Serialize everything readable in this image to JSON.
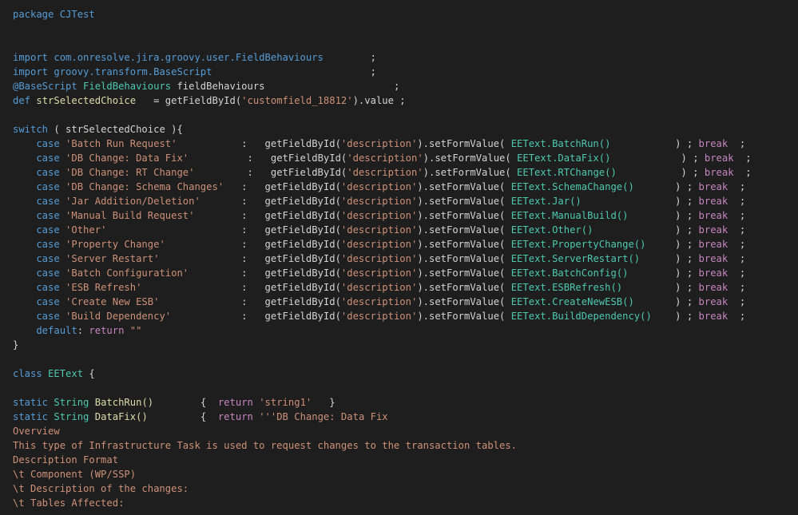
{
  "editor": {
    "theme": {
      "background": "#1e1e1e",
      "default": "#d4d4d4",
      "keyword": "#569cd6",
      "control": "#c586c0",
      "string": "#ce9178",
      "function": "#dcdcaa",
      "class": "#4ec9b0",
      "variable": "#9cdcfe"
    },
    "lines": [
      {
        "row": 0,
        "tokens": [
          {
            "t": "package",
            "c": "kw"
          },
          {
            "t": " CJTest",
            "c": "kw"
          }
        ]
      },
      {
        "row": 3,
        "tokens": [
          {
            "t": "import",
            "c": "kw"
          },
          {
            "t": " com.onresolve.jira.groovy.user.FieldBehaviours",
            "c": "kw"
          },
          {
            "t": "        ;",
            "c": "plain"
          }
        ]
      },
      {
        "row": 4,
        "tokens": [
          {
            "t": "import",
            "c": "kw"
          },
          {
            "t": " groovy.transform.BaseScript",
            "c": "kw"
          },
          {
            "t": "                           ;",
            "c": "plain"
          }
        ]
      },
      {
        "row": 5,
        "tokens": [
          {
            "t": "@BaseScript",
            "c": "kw"
          },
          {
            "t": " FieldBehaviours",
            "c": "cls"
          },
          {
            "t": " fieldBehaviours",
            "c": "plain"
          },
          {
            "t": "                      ;",
            "c": "plain"
          }
        ]
      },
      {
        "row": 6,
        "tokens": [
          {
            "t": "def",
            "c": "kw"
          },
          {
            "t": " strSelectedChoice",
            "c": "fn"
          },
          {
            "t": "   = getFieldById(",
            "c": "plain"
          },
          {
            "t": "'customfield_18812'",
            "c": "str"
          },
          {
            "t": ").value ;",
            "c": "plain"
          }
        ]
      },
      {
        "row": 8,
        "tokens": [
          {
            "t": "switch",
            "c": "kw"
          },
          {
            "t": " ( strSelectedChoice ){",
            "c": "plain"
          }
        ]
      },
      {
        "row": 9,
        "tokens": [
          {
            "t": "    case",
            "c": "kw"
          },
          {
            "t": " 'Batch Run Request'",
            "c": "str"
          },
          {
            "t": "           :   getFieldById(",
            "c": "plain"
          },
          {
            "t": "'description'",
            "c": "str"
          },
          {
            "t": ").setFormValue( ",
            "c": "plain"
          },
          {
            "t": "EEText",
            "c": "cls"
          },
          {
            "t": ".BatchRun()",
            "c": "cls"
          },
          {
            "t": "           ) ; ",
            "c": "plain"
          },
          {
            "t": "break",
            "c": "ctl"
          },
          {
            "t": "  ;",
            "c": "plain"
          }
        ]
      },
      {
        "row": 10,
        "tokens": [
          {
            "t": "    case",
            "c": "kw"
          },
          {
            "t": " 'DB Change: Data Fix'",
            "c": "str"
          },
          {
            "t": "          :   getFieldById(",
            "c": "plain"
          },
          {
            "t": "'description'",
            "c": "str"
          },
          {
            "t": ").setFormValue( ",
            "c": "plain"
          },
          {
            "t": "EEText",
            "c": "cls"
          },
          {
            "t": ".DataFix()",
            "c": "cls"
          },
          {
            "t": "            ) ; ",
            "c": "plain"
          },
          {
            "t": "break",
            "c": "ctl"
          },
          {
            "t": "  ;",
            "c": "plain"
          }
        ]
      },
      {
        "row": 11,
        "tokens": [
          {
            "t": "    case",
            "c": "kw"
          },
          {
            "t": " 'DB Change: RT Change'",
            "c": "str"
          },
          {
            "t": "         :   getFieldById(",
            "c": "plain"
          },
          {
            "t": "'description'",
            "c": "str"
          },
          {
            "t": ").setFormValue( ",
            "c": "plain"
          },
          {
            "t": "EEText",
            "c": "cls"
          },
          {
            "t": ".RTChange()",
            "c": "cls"
          },
          {
            "t": "           ) ; ",
            "c": "plain"
          },
          {
            "t": "break",
            "c": "ctl"
          },
          {
            "t": "  ;",
            "c": "plain"
          }
        ]
      },
      {
        "row": 12,
        "tokens": [
          {
            "t": "    case",
            "c": "kw"
          },
          {
            "t": " 'DB Change: Schema Changes'",
            "c": "str"
          },
          {
            "t": "   :   getFieldById(",
            "c": "plain"
          },
          {
            "t": "'description'",
            "c": "str"
          },
          {
            "t": ").setFormValue( ",
            "c": "plain"
          },
          {
            "t": "EEText",
            "c": "cls"
          },
          {
            "t": ".SchemaChange()",
            "c": "cls"
          },
          {
            "t": "       ) ; ",
            "c": "plain"
          },
          {
            "t": "break",
            "c": "ctl"
          },
          {
            "t": "  ;",
            "c": "plain"
          }
        ]
      },
      {
        "row": 13,
        "tokens": [
          {
            "t": "    case",
            "c": "kw"
          },
          {
            "t": " 'Jar Addition/Deletion'",
            "c": "str"
          },
          {
            "t": "       :   getFieldById(",
            "c": "plain"
          },
          {
            "t": "'description'",
            "c": "str"
          },
          {
            "t": ").setFormValue( ",
            "c": "plain"
          },
          {
            "t": "EEText",
            "c": "cls"
          },
          {
            "t": ".Jar()",
            "c": "cls"
          },
          {
            "t": "                ) ; ",
            "c": "plain"
          },
          {
            "t": "break",
            "c": "ctl"
          },
          {
            "t": "  ;",
            "c": "plain"
          }
        ]
      },
      {
        "row": 14,
        "tokens": [
          {
            "t": "    case",
            "c": "kw"
          },
          {
            "t": " 'Manual Build Request'",
            "c": "str"
          },
          {
            "t": "        :   getFieldById(",
            "c": "plain"
          },
          {
            "t": "'description'",
            "c": "str"
          },
          {
            "t": ").setFormValue( ",
            "c": "plain"
          },
          {
            "t": "EEText",
            "c": "cls"
          },
          {
            "t": ".ManualBuild()",
            "c": "cls"
          },
          {
            "t": "        ) ; ",
            "c": "plain"
          },
          {
            "t": "break",
            "c": "ctl"
          },
          {
            "t": "  ;",
            "c": "plain"
          }
        ]
      },
      {
        "row": 15,
        "tokens": [
          {
            "t": "    case",
            "c": "kw"
          },
          {
            "t": " 'Other'",
            "c": "str"
          },
          {
            "t": "                       :   getFieldById(",
            "c": "plain"
          },
          {
            "t": "'description'",
            "c": "str"
          },
          {
            "t": ").setFormValue( ",
            "c": "plain"
          },
          {
            "t": "EEText",
            "c": "cls"
          },
          {
            "t": ".Other()",
            "c": "cls"
          },
          {
            "t": "              ) ; ",
            "c": "plain"
          },
          {
            "t": "break",
            "c": "ctl"
          },
          {
            "t": "  ;",
            "c": "plain"
          }
        ]
      },
      {
        "row": 16,
        "tokens": [
          {
            "t": "    case",
            "c": "kw"
          },
          {
            "t": " 'Property Change'",
            "c": "str"
          },
          {
            "t": "             :   getFieldById(",
            "c": "plain"
          },
          {
            "t": "'description'",
            "c": "str"
          },
          {
            "t": ").setFormValue( ",
            "c": "plain"
          },
          {
            "t": "EEText",
            "c": "cls"
          },
          {
            "t": ".PropertyChange()",
            "c": "cls"
          },
          {
            "t": "     ) ; ",
            "c": "plain"
          },
          {
            "t": "break",
            "c": "ctl"
          },
          {
            "t": "  ;",
            "c": "plain"
          }
        ]
      },
      {
        "row": 17,
        "tokens": [
          {
            "t": "    case",
            "c": "kw"
          },
          {
            "t": " 'Server Restart'",
            "c": "str"
          },
          {
            "t": "              :   getFieldById(",
            "c": "plain"
          },
          {
            "t": "'description'",
            "c": "str"
          },
          {
            "t": ").setFormValue( ",
            "c": "plain"
          },
          {
            "t": "EEText",
            "c": "cls"
          },
          {
            "t": ".ServerRestart()",
            "c": "cls"
          },
          {
            "t": "      ) ; ",
            "c": "plain"
          },
          {
            "t": "break",
            "c": "ctl"
          },
          {
            "t": "  ;",
            "c": "plain"
          }
        ]
      },
      {
        "row": 18,
        "tokens": [
          {
            "t": "    case",
            "c": "kw"
          },
          {
            "t": " 'Batch Configuration'",
            "c": "str"
          },
          {
            "t": "         :   getFieldById(",
            "c": "plain"
          },
          {
            "t": "'description'",
            "c": "str"
          },
          {
            "t": ").setFormValue( ",
            "c": "plain"
          },
          {
            "t": "EEText",
            "c": "cls"
          },
          {
            "t": ".BatchConfig()",
            "c": "cls"
          },
          {
            "t": "        ) ; ",
            "c": "plain"
          },
          {
            "t": "break",
            "c": "ctl"
          },
          {
            "t": "  ;",
            "c": "plain"
          }
        ]
      },
      {
        "row": 19,
        "tokens": [
          {
            "t": "    case",
            "c": "kw"
          },
          {
            "t": " 'ESB Refresh'",
            "c": "str"
          },
          {
            "t": "                 :   getFieldById(",
            "c": "plain"
          },
          {
            "t": "'description'",
            "c": "str"
          },
          {
            "t": ").setFormValue( ",
            "c": "plain"
          },
          {
            "t": "EEText",
            "c": "cls"
          },
          {
            "t": ".ESBRefresh()",
            "c": "cls"
          },
          {
            "t": "         ) ; ",
            "c": "plain"
          },
          {
            "t": "break",
            "c": "ctl"
          },
          {
            "t": "  ;",
            "c": "plain"
          }
        ]
      },
      {
        "row": 20,
        "tokens": [
          {
            "t": "    case",
            "c": "kw"
          },
          {
            "t": " 'Create New ESB'",
            "c": "str"
          },
          {
            "t": "              :   getFieldById(",
            "c": "plain"
          },
          {
            "t": "'description'",
            "c": "str"
          },
          {
            "t": ").setFormValue( ",
            "c": "plain"
          },
          {
            "t": "EEText",
            "c": "cls"
          },
          {
            "t": ".CreateNewESB()",
            "c": "cls"
          },
          {
            "t": "       ) ; ",
            "c": "plain"
          },
          {
            "t": "break",
            "c": "ctl"
          },
          {
            "t": "  ;",
            "c": "plain"
          }
        ]
      },
      {
        "row": 21,
        "tokens": [
          {
            "t": "    case",
            "c": "kw"
          },
          {
            "t": " 'Build Dependency'",
            "c": "str"
          },
          {
            "t": "            :   getFieldById(",
            "c": "plain"
          },
          {
            "t": "'description'",
            "c": "str"
          },
          {
            "t": ").setFormValue( ",
            "c": "plain"
          },
          {
            "t": "EEText",
            "c": "cls"
          },
          {
            "t": ".BuildDependency()",
            "c": "cls"
          },
          {
            "t": "    ) ; ",
            "c": "plain"
          },
          {
            "t": "break",
            "c": "ctl"
          },
          {
            "t": "  ;",
            "c": "plain"
          }
        ]
      },
      {
        "row": 22,
        "tokens": [
          {
            "t": "    default",
            "c": "kw"
          },
          {
            "t": ": ",
            "c": "plain"
          },
          {
            "t": "return",
            "c": "ctl"
          },
          {
            "t": " \"\"",
            "c": "str"
          }
        ]
      },
      {
        "row": 23,
        "tokens": [
          {
            "t": "}",
            "c": "plain"
          }
        ]
      },
      {
        "row": 25,
        "tokens": [
          {
            "t": "class",
            "c": "kw"
          },
          {
            "t": " EEText",
            "c": "cls"
          },
          {
            "t": " {",
            "c": "plain"
          }
        ]
      },
      {
        "row": 27,
        "tokens": [
          {
            "t": "static",
            "c": "kw"
          },
          {
            "t": " String",
            "c": "cls"
          },
          {
            "t": " BatchRun()",
            "c": "fn"
          },
          {
            "t": "        {  ",
            "c": "plain"
          },
          {
            "t": "return",
            "c": "ctl"
          },
          {
            "t": " 'string1'",
            "c": "str"
          },
          {
            "t": "   }",
            "c": "plain"
          }
        ]
      },
      {
        "row": 28,
        "tokens": [
          {
            "t": "static",
            "c": "kw"
          },
          {
            "t": " String",
            "c": "cls"
          },
          {
            "t": " DataFix()",
            "c": "fn"
          },
          {
            "t": "         {  ",
            "c": "plain"
          },
          {
            "t": "return",
            "c": "ctl"
          },
          {
            "t": " '''DB Change: Data Fix",
            "c": "str"
          }
        ]
      },
      {
        "row": 29,
        "tokens": [
          {
            "t": "Overview",
            "c": "str"
          }
        ]
      },
      {
        "row": 30,
        "tokens": [
          {
            "t": "This type of Infrastructure Task is used to request changes to the transaction tables.",
            "c": "str"
          }
        ]
      },
      {
        "row": 31,
        "tokens": [
          {
            "t": "Description Format",
            "c": "str"
          }
        ]
      },
      {
        "row": 32,
        "tokens": [
          {
            "t": "\\t Component (WP/SSP)",
            "c": "str"
          }
        ]
      },
      {
        "row": 33,
        "tokens": [
          {
            "t": "\\t Description of the changes:",
            "c": "str"
          }
        ]
      },
      {
        "row": 34,
        "tokens": [
          {
            "t": "\\t Tables Affected:",
            "c": "str"
          }
        ]
      }
    ]
  }
}
